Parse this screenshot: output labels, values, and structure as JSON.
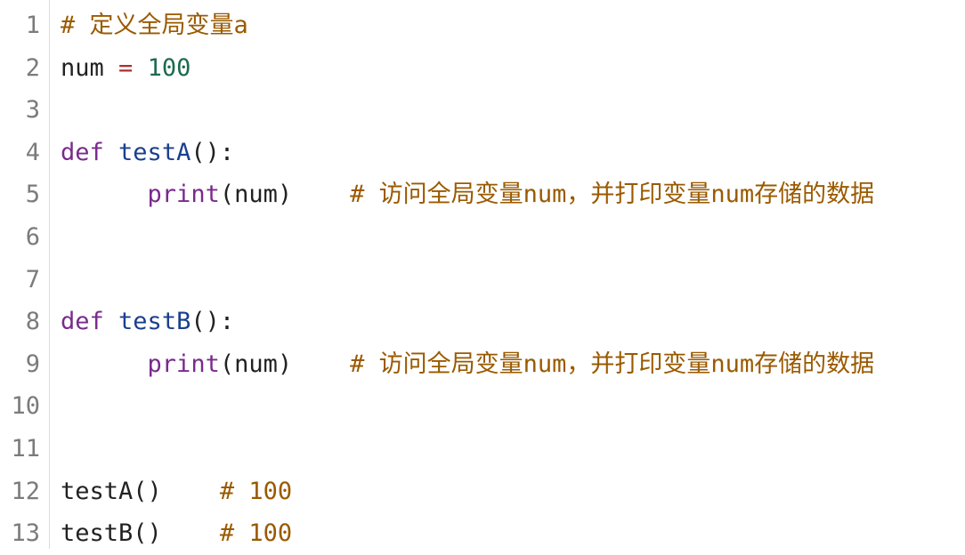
{
  "editor": {
    "line_numbers": [
      "1",
      "2",
      "3",
      "4",
      "5",
      "6",
      "7",
      "8",
      "9",
      "10",
      "11",
      "12",
      "13"
    ],
    "lines": [
      {
        "parts": [
          {
            "t": "comment",
            "text": "# 定义全局变量a"
          }
        ]
      },
      {
        "parts": [
          {
            "t": "plain",
            "text": "num "
          },
          {
            "t": "op",
            "text": "="
          },
          {
            "t": "plain",
            "text": " "
          },
          {
            "t": "num",
            "text": "100"
          }
        ]
      },
      {
        "parts": []
      },
      {
        "parts": [
          {
            "t": "kw",
            "text": "def"
          },
          {
            "t": "plain",
            "text": " "
          },
          {
            "t": "fn",
            "text": "testA"
          },
          {
            "t": "plain",
            "text": "():"
          }
        ]
      },
      {
        "parts": [
          {
            "t": "plain",
            "text": "      "
          },
          {
            "t": "builtin",
            "text": "print"
          },
          {
            "t": "plain",
            "text": "(num)    "
          },
          {
            "t": "comment",
            "text": "# 访问全局变量num，并打印变量num存储的数据"
          }
        ]
      },
      {
        "parts": []
      },
      {
        "parts": []
      },
      {
        "parts": [
          {
            "t": "kw",
            "text": "def"
          },
          {
            "t": "plain",
            "text": " "
          },
          {
            "t": "fn",
            "text": "testB"
          },
          {
            "t": "plain",
            "text": "():"
          }
        ]
      },
      {
        "parts": [
          {
            "t": "plain",
            "text": "      "
          },
          {
            "t": "builtin",
            "text": "print"
          },
          {
            "t": "plain",
            "text": "(num)    "
          },
          {
            "t": "comment",
            "text": "# 访问全局变量num，并打印变量num存储的数据"
          }
        ]
      },
      {
        "parts": []
      },
      {
        "parts": []
      },
      {
        "parts": [
          {
            "t": "plain",
            "text": "testA()    "
          },
          {
            "t": "comment",
            "text": "# 100"
          }
        ]
      },
      {
        "parts": [
          {
            "t": "plain",
            "text": "testB()    "
          },
          {
            "t": "comment",
            "text": "# 100"
          }
        ]
      }
    ]
  },
  "colors": {
    "comment": "#9a5a00",
    "keyword": "#7a2a8c",
    "function": "#1a3f8f",
    "number": "#1c6b4f",
    "operator": "#b02e2e",
    "line_number": "#7b7b7b"
  }
}
